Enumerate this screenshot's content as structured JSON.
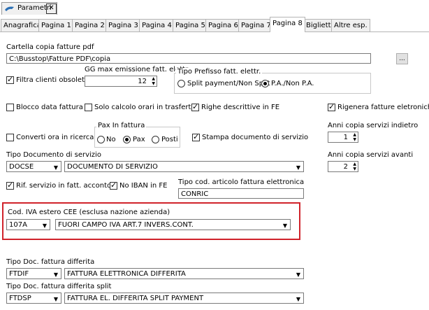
{
  "window": {
    "tab_title": "Parametri",
    "close_glyph": "✕"
  },
  "tabs": [
    {
      "label": "Anagrafica"
    },
    {
      "label": "Pagina 1"
    },
    {
      "label": "Pagina 2"
    },
    {
      "label": "Pagina 3"
    },
    {
      "label": "Pagina 4"
    },
    {
      "label": "Pagina 5"
    },
    {
      "label": "Pagina 6"
    },
    {
      "label": "Pagina 7"
    },
    {
      "label": "Pagina 8",
      "active": true
    },
    {
      "label": "Biglietti"
    },
    {
      "label": "Altre esp."
    }
  ],
  "cartella": {
    "label": "Cartella copia fatture pdf",
    "value": "C:\\Busstop\\Fatture PDF\\copia",
    "browse_label": "..."
  },
  "filtra_clienti": {
    "label": "Filtra clienti obsoleti",
    "checked": true
  },
  "gg_max": {
    "label": "GG max emissione fatt. elettr.",
    "value": "12"
  },
  "tipo_prefisso": {
    "title": "Tipo Prefisso fatt. elettr.",
    "opt1": "Split payment/Non Split",
    "opt2": "P.A./Non P.A.",
    "selected": 2
  },
  "checks_row1": {
    "blocco": "Blocco data fattura",
    "solo_calcolo": "Solo calcolo orari in trasferte",
    "righe": "Righe descrittive in FE",
    "rigenera": "Rigenera fatture eletroniche"
  },
  "converti": {
    "label": "Converti ora in ricerca"
  },
  "pax": {
    "title": "Pax In fattura",
    "opt_no": "No",
    "opt_pax": "Pax",
    "opt_posti": "Posti",
    "selected": "Pax"
  },
  "stampa": {
    "label": "Stampa documento di servizio"
  },
  "anni_indietro": {
    "label": "Anni copia servizi indietro",
    "value": "1"
  },
  "tipo_doc_servizio": {
    "label": "Tipo Documento di servizio",
    "code": "DOCSE",
    "desc": "DOCUMENTO DI SERVIZIO"
  },
  "anni_avanti": {
    "label": "Anni copia servizi avanti",
    "value": "2"
  },
  "rif_servizio": {
    "label": "Rif. servizio in fatt. acconto"
  },
  "no_iban": {
    "label": "No IBAN in FE"
  },
  "tipo_cod_articolo": {
    "label": "Tipo cod. articolo fattura elettronica",
    "value": "CONRIC"
  },
  "cod_iva": {
    "label": "Cod. IVA estero CEE (esclusa nazione azienda)",
    "code": "107A",
    "desc": "FUORI CAMPO IVA ART.7 INVERS.CONT."
  },
  "doc_differita": {
    "label": "Tipo Doc. fattura differita",
    "code": "FTDIF",
    "desc": "FATTURA ELETTRONICA DIFFERITA"
  },
  "doc_differita_split": {
    "label": "Tipo Doc. fattura differita split",
    "code": "FTDSP",
    "desc": "FATTURA EL. DIFFERITA SPLIT PAYMENT"
  },
  "colors": {
    "highlight": "#d0232b"
  }
}
